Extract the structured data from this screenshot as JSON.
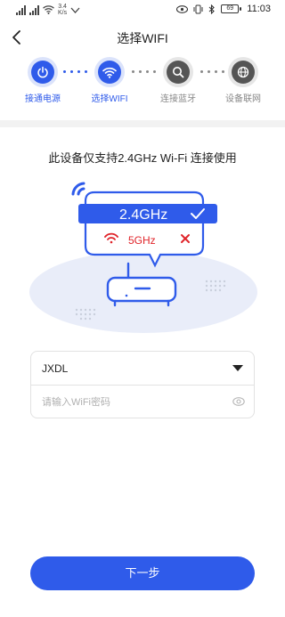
{
  "status_bar": {
    "network_speed_value": "3.4",
    "network_speed_unit": "K/s",
    "battery_level": "69",
    "time": "11:03"
  },
  "header": {
    "title": "选择WIFI"
  },
  "steps": [
    {
      "label": "接通电源",
      "icon": "power-icon",
      "active": true
    },
    {
      "label": "选择WIFI",
      "icon": "wifi-icon",
      "active": true
    },
    {
      "label": "连接蓝牙",
      "icon": "search-icon",
      "active": false
    },
    {
      "label": "设备联网",
      "icon": "globe-icon",
      "active": false
    }
  ],
  "main": {
    "headline": "此设备仅支持2.4GHz Wi-Fi 连接使用",
    "illustration": {
      "supported_band": "2.4GHz",
      "unsupported_band": "5GHz"
    }
  },
  "form": {
    "ssid_value": "JXDL",
    "password_placeholder": "请输入WiFi密码"
  },
  "footer": {
    "next_label": "下一步"
  },
  "colors": {
    "accent": "#2f5bea",
    "error": "#e0242a",
    "inactive_step": "#555555"
  }
}
